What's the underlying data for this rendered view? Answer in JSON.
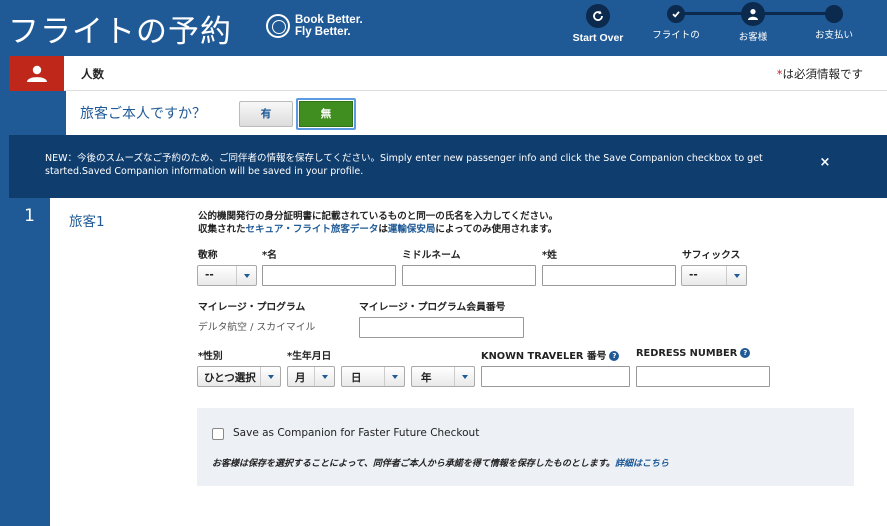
{
  "header": {
    "title": "フライトの予約",
    "brand_line1": "Book Better.",
    "brand_line2": "Fly Better.",
    "start_over": "Start Over",
    "steps": [
      {
        "label": "フライトの"
      },
      {
        "label": "お客様"
      },
      {
        "label": "お支払い"
      }
    ]
  },
  "section": {
    "label": "人数",
    "required_asterisk": "*",
    "required_text": "は必須情報です"
  },
  "question": {
    "text": "旅客ご本人ですか？",
    "yes": "有",
    "no": "無",
    "selected": "無"
  },
  "notice": {
    "text": "NEW：今後のスムーズなご予約のため、ご同伴者の情報を保存してください。Simply enter new passenger info and click the Save Companion checkbox to get started.Saved Companion information will be saved in your profile.",
    "close": "×"
  },
  "passenger": {
    "number": "1",
    "title": "旅客1",
    "desc_line1": "公的機関発行の身分証明書に記載されているものと同一の氏名を入力してください。",
    "desc_prefix": "収集された",
    "desc_link1": "セキュア・フライト旅客データ",
    "desc_middle": "は",
    "desc_link2": "運輸保安局",
    "desc_suffix": "によってのみ使用されます。",
    "fields": {
      "title_label": "敬称",
      "title_value": "--",
      "first_label": "*名",
      "first_value": "",
      "middle_label": "ミドルネーム",
      "middle_value": "",
      "last_label": "*姓",
      "last_value": "",
      "suffix_label": "サフィックス",
      "suffix_value": "--",
      "mileage_label": "マイレージ・プログラム",
      "mileage_value": "デルタ航空 / スカイマイル",
      "member_label": "マイレージ・プログラム会員番号",
      "member_value": "",
      "gender_label": "*性別",
      "gender_value": "ひとつ選択",
      "dob_label": "*生年月日",
      "month_value": "月",
      "day_value": "日",
      "year_value": "年",
      "ktn_label": "KNOWN TRAVELER 番号",
      "ktn_value": "",
      "redress_label": "REDRESS NUMBER",
      "redress_value": "",
      "help_glyph": "?"
    },
    "companion": {
      "checkbox_label": "Save as Companion for Faster Future Checkout",
      "checked": false,
      "note": "お客様は保存を選択することによって、同伴者ご本人から承諾を得て情報を保存したものとします。",
      "note_link": "詳細はこちら"
    }
  },
  "colors": {
    "brand_blue": "#1f5a96",
    "dark_navy": "#0f3d6e",
    "accent_red": "#c0271b",
    "selected_green": "#3f8e1f"
  }
}
